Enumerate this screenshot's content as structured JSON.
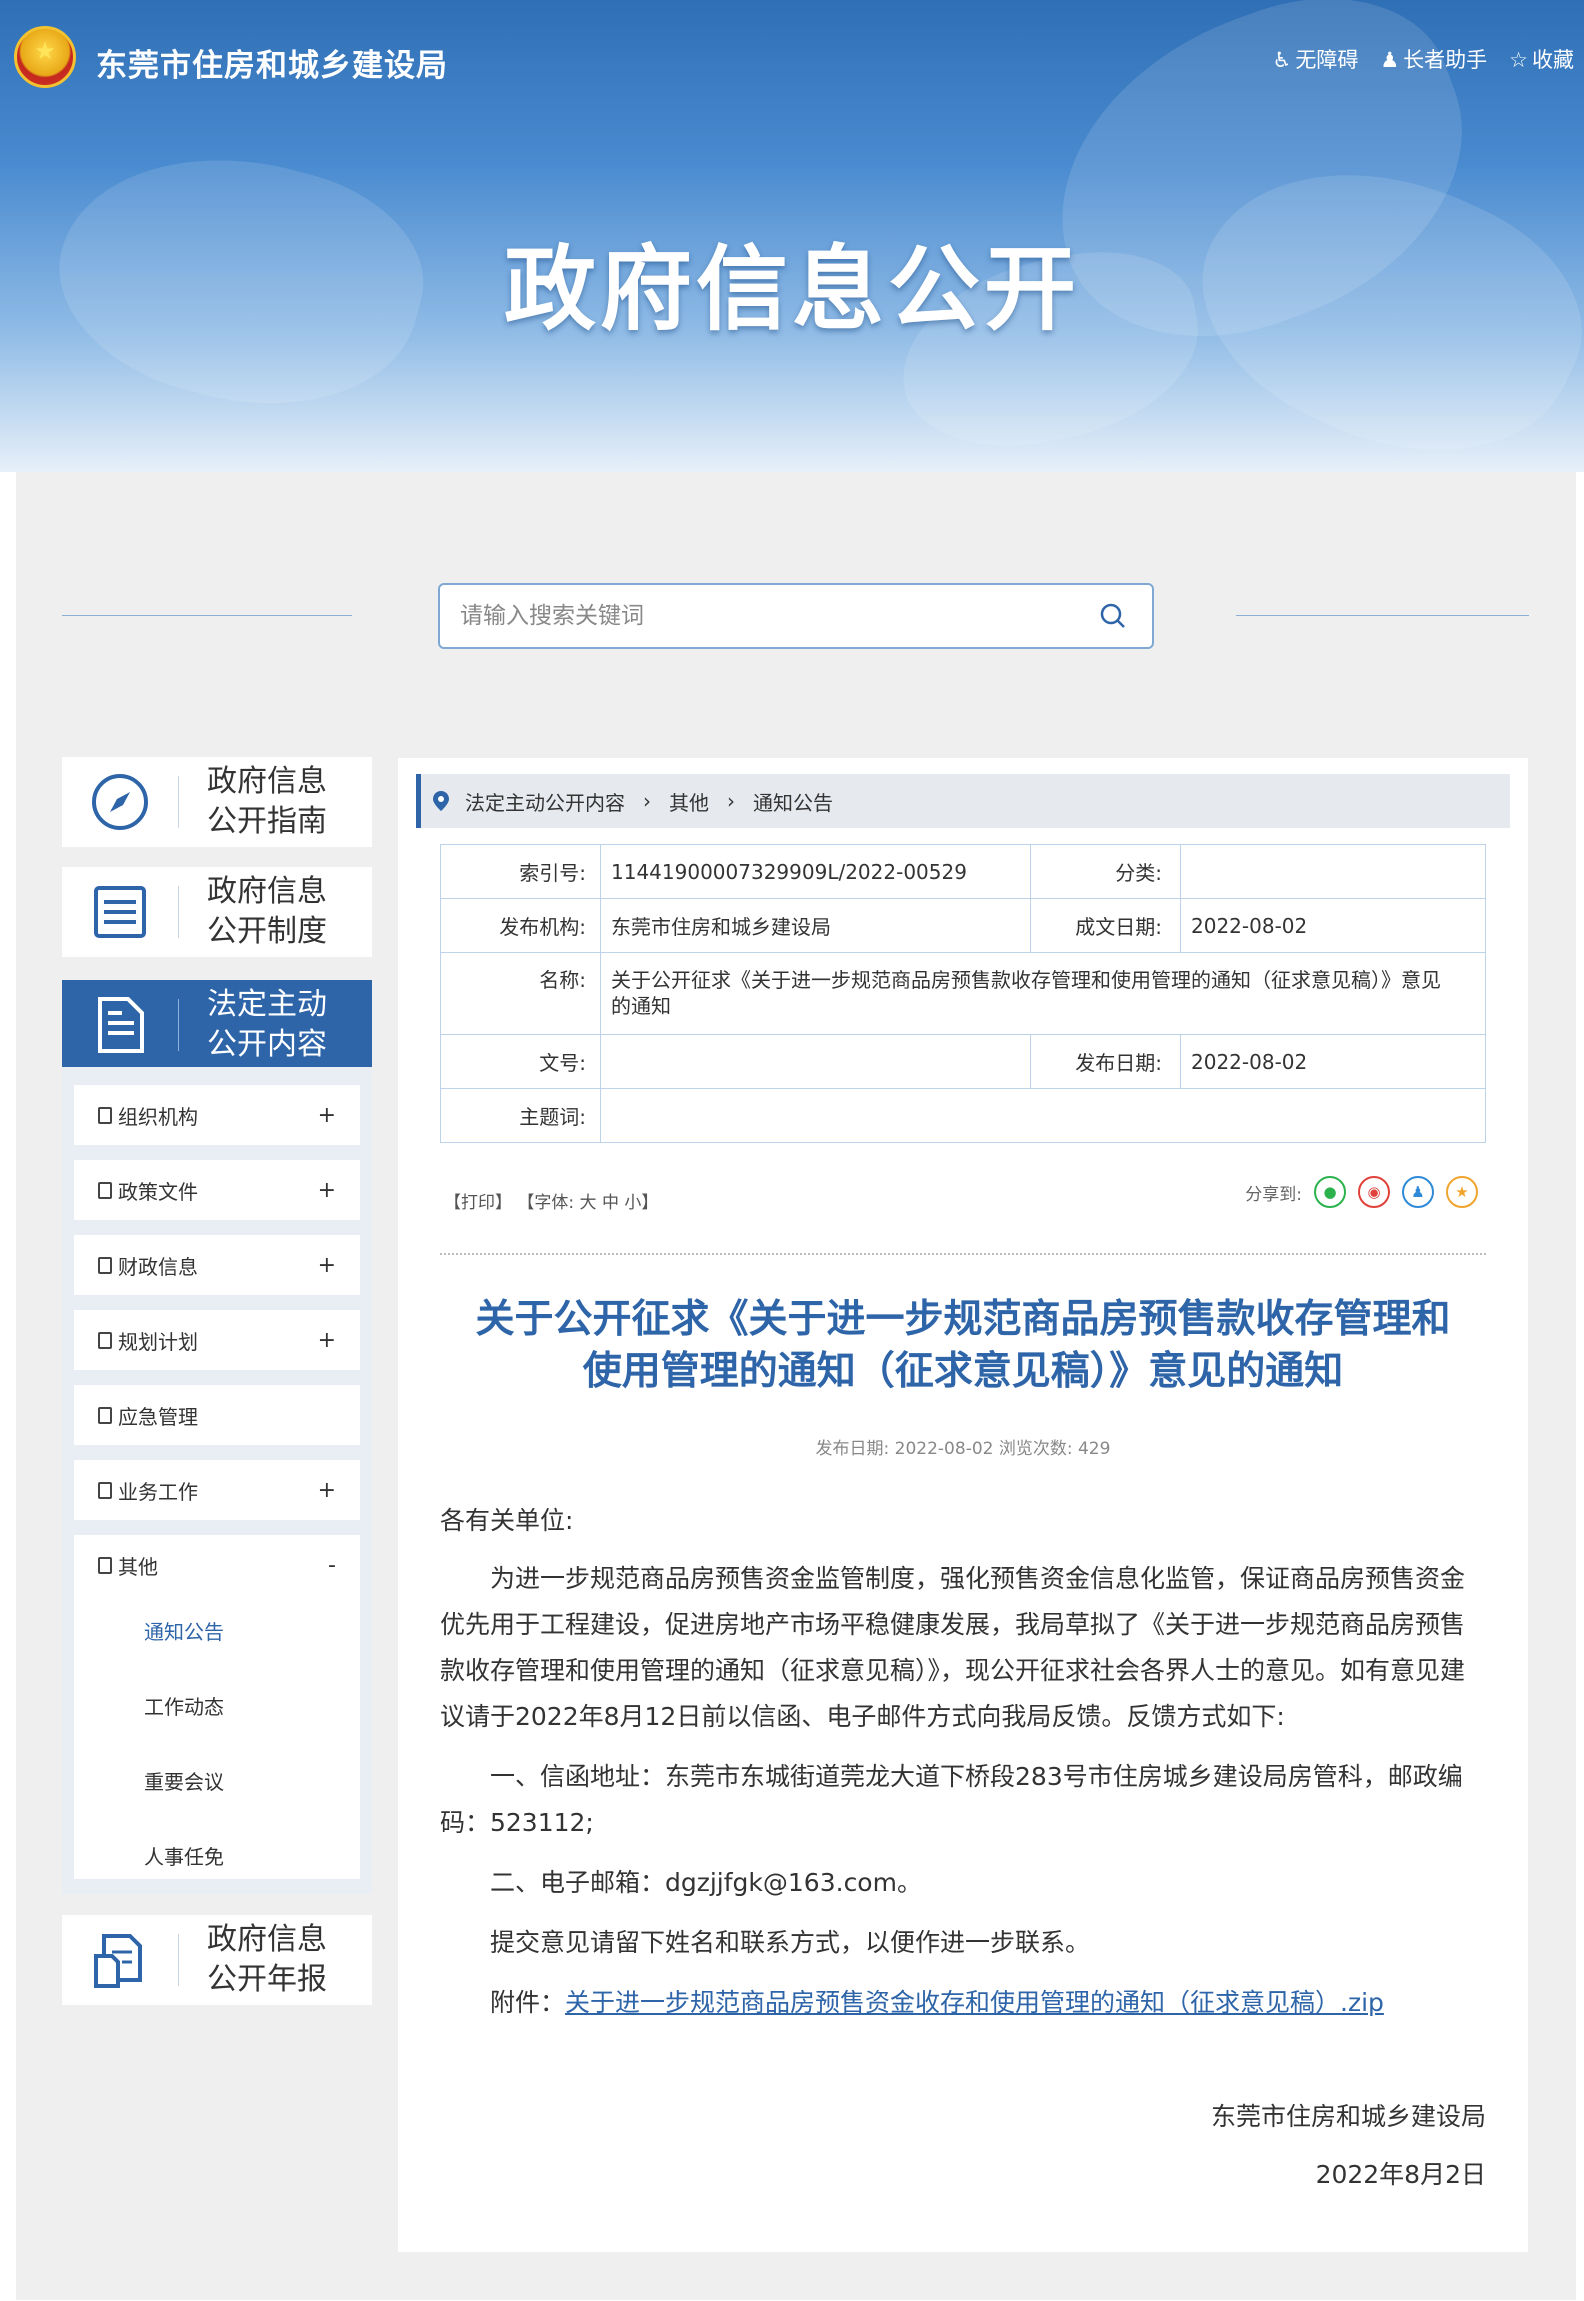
{
  "header": {
    "site_name": "东莞市住房和城乡建设局",
    "banner_title": "政府信息公开",
    "links": {
      "accessibility": "无障碍",
      "elderly": "长者助手",
      "favorite": "收藏"
    }
  },
  "search": {
    "placeholder": "请输入搜索关键词"
  },
  "sidebar": {
    "guide": [
      "政府信息",
      "公开指南"
    ],
    "system": [
      "政府信息",
      "公开制度"
    ],
    "active": [
      "法定主动",
      "公开内容"
    ],
    "annual": [
      "政府信息",
      "公开年报"
    ],
    "menu": [
      {
        "label": "组织机构",
        "toggle": "+"
      },
      {
        "label": "政策文件",
        "toggle": "+"
      },
      {
        "label": "财政信息",
        "toggle": "+"
      },
      {
        "label": "规划计划",
        "toggle": "+"
      },
      {
        "label": "应急管理",
        "toggle": ""
      },
      {
        "label": "业务工作",
        "toggle": "+"
      }
    ],
    "open_group": {
      "label": "其他",
      "toggle": "-",
      "children": [
        "通知公告",
        "工作动态",
        "重要会议",
        "人事任免"
      ]
    }
  },
  "breadcrumb": [
    "法定主动公开内容",
    "其他",
    "通知公告"
  ],
  "meta": {
    "index_label": "索引号:",
    "index_value": "11441900007329909L/2022-00529",
    "category_label": "分类:",
    "category_value": "",
    "publisher_label": "发布机构:",
    "publisher_value": "东莞市住房和城乡建设局",
    "created_label": "成文日期:",
    "created_value": "2022-08-02",
    "name_label": "名称:",
    "name_value": "关于公开征求《关于进一步规范商品房预售款收存管理和使用管理的通知（征求意见稿）》意见的通知",
    "docno_label": "文号:",
    "docno_value": "",
    "pubdate_label": "发布日期:",
    "pubdate_value": "2022-08-02",
    "keywords_label": "主题词:",
    "keywords_value": ""
  },
  "tools": {
    "print": "【打印】",
    "font": "【字体:",
    "large": "大",
    "medium": "中",
    "small": "小】",
    "share_label": "分享到:"
  },
  "article": {
    "title_line1": "关于公开征求《关于进一步规范商品房预售款收存管理和",
    "title_line2": "使用管理的通知（征求意见稿）》意见的通知",
    "info": "发布日期: 2022-08-02  浏览次数: 429",
    "greeting": "各有关单位:",
    "p1": "为进一步规范商品房预售资金监管制度，强化预售资金信息化监管，保证商品房预售资金优先用于工程建设，促进房地产市场平稳健康发展，我局草拟了《关于进一步规范商品房预售款收存管理和使用管理的通知（征求意见稿）》，现公开征求社会各界人士的意见。如有意见建议请于2022年8月12日前以信函、电子邮件方式向我局反馈。反馈方式如下:",
    "p2": "一、信函地址：东莞市东城街道莞龙大道下桥段283号市住房城乡建设局房管科，邮政编码：523112;",
    "p3": "二、电子邮箱：dgzjjfgk@163.com。",
    "p4": "提交意见请留下姓名和联系方式，以便作进一步联系。",
    "attach_label": "附件：",
    "attach_link": "关于进一步规范商品房预售资金收存和使用管理的通知（征求意见稿）.zip",
    "signer": "东莞市住房和城乡建设局",
    "date": "2022年8月2日"
  }
}
